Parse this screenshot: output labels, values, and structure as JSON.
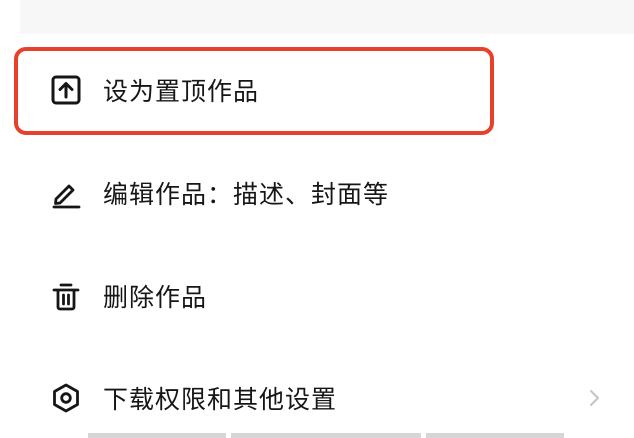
{
  "menu": {
    "pin": {
      "label": "设为置顶作品",
      "icon": "pin-top-icon"
    },
    "edit": {
      "label": "编辑作品：描述、封面等",
      "icon": "pencil-icon"
    },
    "delete": {
      "label": "删除作品",
      "icon": "trash-icon"
    },
    "permissions": {
      "label": "下载权限和其他设置",
      "icon": "settings-hexagon-icon"
    }
  },
  "colors": {
    "highlight": "#e8412b",
    "text": "#161616",
    "chevron": "#c4c4c4"
  }
}
